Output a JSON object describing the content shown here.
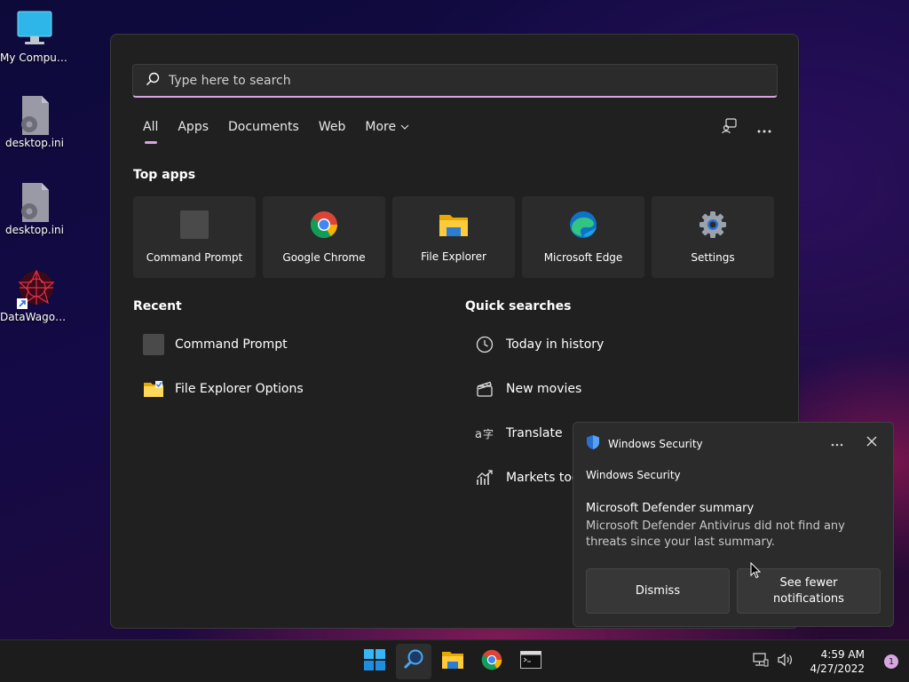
{
  "desktop": {
    "icons": [
      {
        "label": "My Computer",
        "icon": "monitor-icon"
      },
      {
        "label": "desktop.ini",
        "icon": "settings-file-icon"
      },
      {
        "label": "desktop.ini",
        "icon": "settings-file-icon"
      },
      {
        "label": "DataWagon...",
        "icon": "shortcut-app-icon"
      }
    ]
  },
  "search": {
    "placeholder": "Type here to search",
    "tabs": [
      {
        "label": "All",
        "active": true
      },
      {
        "label": "Apps"
      },
      {
        "label": "Documents"
      },
      {
        "label": "Web"
      },
      {
        "label": "More"
      }
    ],
    "top_apps_title": "Top apps",
    "top_apps": [
      {
        "label": "Command Prompt",
        "icon": "command-prompt-icon"
      },
      {
        "label": "Google Chrome",
        "icon": "chrome-icon"
      },
      {
        "label": "File Explorer",
        "icon": "file-explorer-icon"
      },
      {
        "label": "Microsoft Edge",
        "icon": "edge-icon"
      },
      {
        "label": "Settings",
        "icon": "gear-icon"
      }
    ],
    "recent_title": "Recent",
    "recent": [
      {
        "label": "Command Prompt",
        "icon": "command-prompt-icon"
      },
      {
        "label": "File Explorer Options",
        "icon": "folder-options-icon"
      }
    ],
    "quick_title": "Quick searches",
    "quick": [
      {
        "label": "Today in history",
        "icon": "clock-icon"
      },
      {
        "label": "New movies",
        "icon": "clapperboard-icon"
      },
      {
        "label": "Translate",
        "icon": "translate-icon"
      },
      {
        "label": "Markets tod",
        "icon": "chart-up-icon"
      }
    ]
  },
  "toast": {
    "app": "Windows Security",
    "subhead": "Windows Security",
    "title": "Microsoft Defender summary",
    "body": "Microsoft Defender Antivirus did not find any threats since your last summary.",
    "dismiss": "Dismiss",
    "fewer_line1": "See fewer",
    "fewer_line2": "notifications"
  },
  "taskbar": {
    "time": "4:59 AM",
    "date": "4/27/2022",
    "notification_count": "1"
  },
  "colors": {
    "accent": "#d7a6e0",
    "panel": "#202020",
    "tile": "#2b2b2b"
  }
}
